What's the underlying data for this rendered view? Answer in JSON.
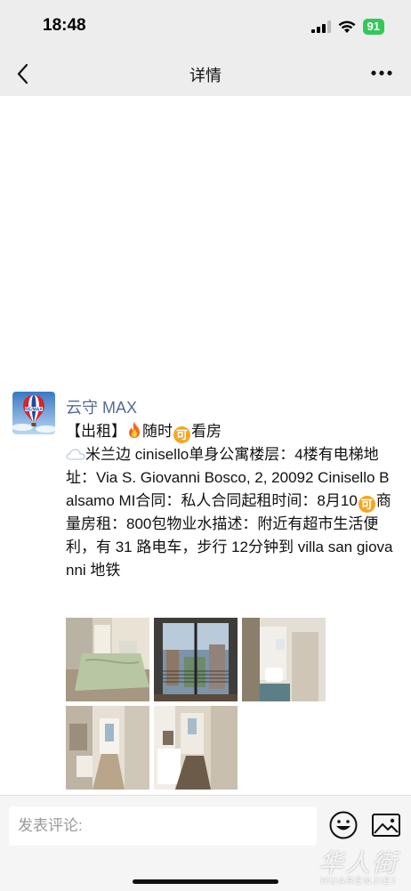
{
  "status_bar": {
    "time": "18:48",
    "battery": "91"
  },
  "nav": {
    "title": "详情"
  },
  "post": {
    "author": "云守 MAX",
    "avatar_text": "RE/MAX",
    "lines": {
      "l1_a": "【出租】",
      "l1_b": "随时",
      "l1_c": "看房",
      "l2_a": "米兰边 cinisello单身公寓楼层：4楼有电梯地址：Via S. Giovanni Bosco, 2, 20092 Cinisello Balsamo MI合同：私人合同起租时间：8月10",
      "l2_b": "商量房租：800包物业水描述：附近有超市生活便利，有 31 路电车，步行 12分钟到 villa san giovanni 地铁"
    },
    "ke_glyph": "可",
    "photo_count": 5
  },
  "comment": {
    "placeholder": "发表评论:"
  },
  "watermark": {
    "main": "华人街",
    "sub": "HUARENJIEI"
  },
  "colors": {
    "header_bg": "#ededed",
    "author": "#576b95",
    "battery": "#34c759",
    "badge": "#f5a623"
  }
}
